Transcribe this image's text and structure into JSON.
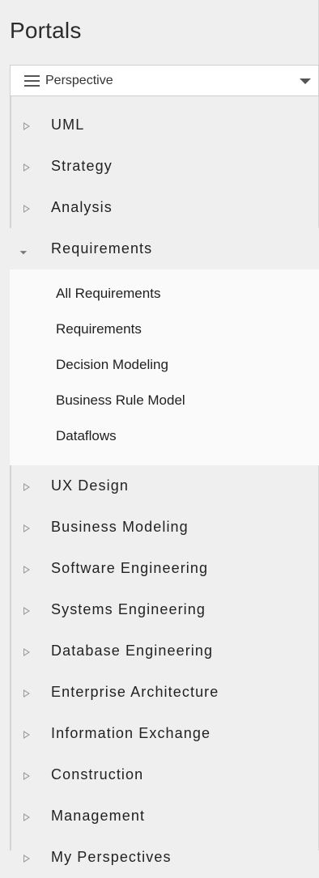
{
  "panel": {
    "title": "Portals",
    "perspective": {
      "icon": "menu-icon",
      "value": "Perspective",
      "dropdown_icon": "chevron-down-icon"
    }
  },
  "tree": {
    "items": [
      {
        "label": "UML",
        "expanded": false
      },
      {
        "label": "Strategy",
        "expanded": false
      },
      {
        "label": "Analysis",
        "expanded": false
      },
      {
        "label": "Requirements",
        "expanded": true,
        "children": [
          "All Requirements",
          "Requirements",
          "Decision Modeling",
          "Business Rule Model",
          "Dataflows"
        ]
      },
      {
        "label": "UX Design",
        "expanded": false
      },
      {
        "label": "Business Modeling",
        "expanded": false
      },
      {
        "label": "Software Engineering",
        "expanded": false
      },
      {
        "label": "Systems Engineering",
        "expanded": false
      },
      {
        "label": "Database Engineering",
        "expanded": false
      },
      {
        "label": "Enterprise Architecture",
        "expanded": false
      },
      {
        "label": "Information Exchange",
        "expanded": false
      },
      {
        "label": "Construction",
        "expanded": false
      },
      {
        "label": "Management",
        "expanded": false
      },
      {
        "label": "My Perspectives",
        "expanded": false
      }
    ]
  },
  "colors": {
    "panel_background": "#efefef",
    "expanded_background": "#fafafa",
    "text": "#222222",
    "arrow": "#9c9c9c"
  }
}
